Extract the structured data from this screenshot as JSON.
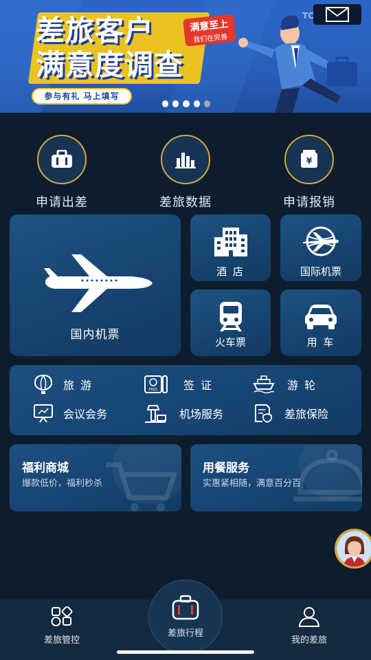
{
  "banner": {
    "title_line1": "差旅客户",
    "title_line2": "满意度调查",
    "stamp_line1": "满意至上",
    "stamp_line2": "我们在完善",
    "pill": "参与有礼  马上填写",
    "corner_text": "TC 差旅天下",
    "slides_total": 5,
    "active_slide": 5
  },
  "quick_actions": [
    {
      "label": "申请出差",
      "icon": "briefcase-icon"
    },
    {
      "label": "差旅数据",
      "icon": "bar-chart-icon"
    },
    {
      "label": "申请报销",
      "icon": "yen-wallet-icon"
    }
  ],
  "tiles": {
    "domestic_flight": "国内机票",
    "hotel": "酒 店",
    "international_flight": "国际机票",
    "train": "火车票",
    "car": "用 车"
  },
  "services": [
    {
      "label": "旅 游",
      "icon": "balloon-icon"
    },
    {
      "label": "签 证",
      "icon": "passport-icon"
    },
    {
      "label": "游 轮",
      "icon": "cruise-ship-icon"
    },
    {
      "label": "会议会务",
      "icon": "presentation-board-icon"
    },
    {
      "label": "机场服务",
      "icon": "control-tower-icon"
    },
    {
      "label": "差旅保险",
      "icon": "insurance-document-icon"
    }
  ],
  "promos": [
    {
      "title": "福利商城",
      "subtitle": "爆款低价，福利秒杀"
    },
    {
      "title": "用餐服务",
      "subtitle": "实惠紧相随，满意百分百"
    }
  ],
  "nav": {
    "left": "差旅管控",
    "center": "差旅行程",
    "right": "我的差旅"
  },
  "colors": {
    "background": "#0e1d2e",
    "tile": "#174470",
    "accent_gold": "#d4a93a",
    "banner_blue": "#2b66c7",
    "banner_yellow": "#f4c81a",
    "stamp_red": "#e4372d",
    "nav_bg": "#142a40"
  }
}
